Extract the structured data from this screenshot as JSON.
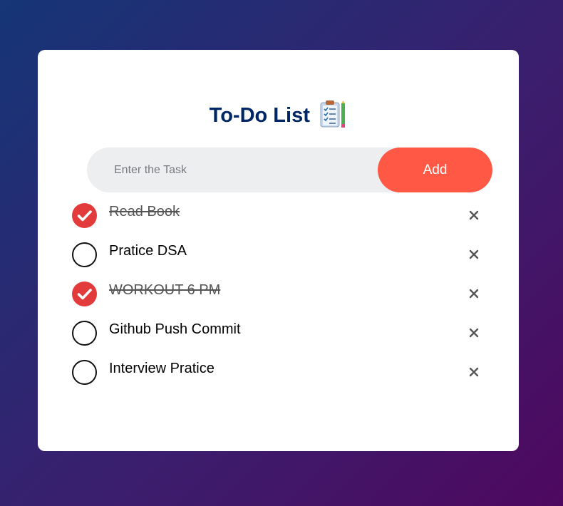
{
  "header": {
    "title": "To-Do List",
    "title_icon": "clipboard-checklist-icon"
  },
  "input": {
    "placeholder": "Enter the Task",
    "value": ""
  },
  "add_button": {
    "label": "Add"
  },
  "colors": {
    "title": "#002765",
    "accent": "#ff5945",
    "checked": "#e33b3b",
    "input_bg": "#edeef0",
    "background_start": "#153677",
    "background_end": "#4e085f"
  },
  "tasks": [
    {
      "label": "Read Book",
      "checked": true,
      "delete_icon": "close-icon"
    },
    {
      "label": "Pratice DSA",
      "checked": false,
      "delete_icon": "close-icon"
    },
    {
      "label": "WORKOUT 6 PM",
      "checked": true,
      "delete_icon": "close-icon"
    },
    {
      "label": "Github Push Commit",
      "checked": false,
      "delete_icon": "close-icon"
    },
    {
      "label": "Interview Pratice",
      "checked": false,
      "delete_icon": "close-icon"
    }
  ]
}
